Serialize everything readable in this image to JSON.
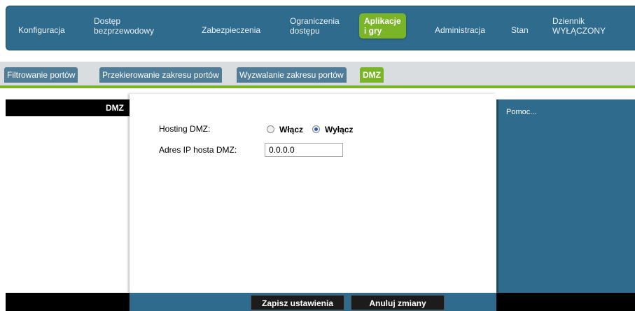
{
  "nav": {
    "items": [
      {
        "label": "Konfiguracja"
      },
      {
        "label": "Dostęp\nbezprzewodowy"
      },
      {
        "label": "Zabezpieczenia"
      },
      {
        "label": "Ograniczenia\ndostępu"
      },
      {
        "label": "Aplikacje\ni gry",
        "active": true
      },
      {
        "label": "Administracja"
      },
      {
        "label": "Stan"
      },
      {
        "label": "Dziennik\nWYŁĄCZONY"
      }
    ]
  },
  "subtabs": {
    "items": [
      {
        "label": "Filtrowanie portów"
      },
      {
        "label": "Przekierowanie zakresu portów"
      },
      {
        "label": "Wyzwalanie zakresu portów"
      },
      {
        "label": "DMZ",
        "active": true
      }
    ]
  },
  "sidebar": {
    "title": "DMZ"
  },
  "form": {
    "hosting_label": "Hosting DMZ:",
    "enable_label": "Włącz",
    "disable_label": "Wyłącz",
    "selected": "Wyłącz",
    "ip_label": "Adres IP hosta DMZ:",
    "ip_value": "0.0.0.0"
  },
  "help": {
    "text": "Pomoc..."
  },
  "footer": {
    "save_label": "Zapisz ustawienia",
    "cancel_label": "Anuluj zmiany"
  },
  "colors": {
    "nav_bg": "#2f6b8c",
    "accent_green": "#7ab528",
    "tab_bg": "#4f7d97",
    "button_bg": "#1c1c1c"
  }
}
